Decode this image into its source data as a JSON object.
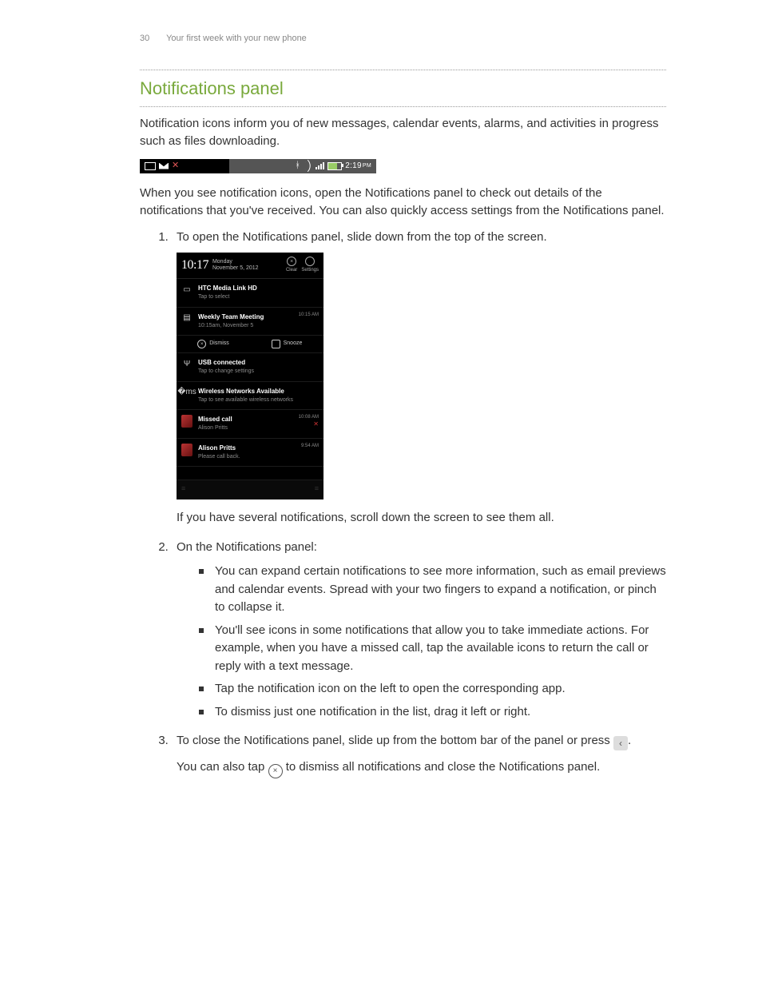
{
  "header": {
    "page_number": "30",
    "running_title": "Your first week with your new phone"
  },
  "section": {
    "title": "Notifications panel"
  },
  "intro1": "Notification icons inform you of new messages, calendar events, alarms, and activities in progress such as files downloading.",
  "statusbar": {
    "time": "2:19",
    "ampm": "PM"
  },
  "intro2": "When you see notification icons, open the Notifications panel to check out details of the notifications that you've received. You can also quickly access settings from the Notifications panel.",
  "steps": {
    "s1": "To open the Notifications panel, slide down from the top of the screen.",
    "s1_after": "If you have several notifications, scroll down the screen to see them all.",
    "s2_intro": "On the Notifications panel:",
    "s2_bullets": [
      "You can expand certain notifications to see more information, such as email previews and calendar events. Spread with your two fingers to expand a notification, or pinch to collapse it.",
      "You'll see icons in some notifications that allow you to take immediate actions. For example, when you have a missed call, tap the available icons to return the call or reply with a text message.",
      "Tap the notification icon on the left to open the corresponding app.",
      "To dismiss just one notification in the list, drag it left or right."
    ],
    "s3_a": "To close the Notifications panel, slide up from the bottom bar of the panel or press ",
    "s3_b": ".",
    "s3_after_a": "You can also tap ",
    "s3_after_b": " to dismiss all notifications and close the Notifications panel."
  },
  "panel": {
    "clock": "10:17",
    "day": "Monday",
    "date": "November 5, 2012",
    "clear": "Clear",
    "settings": "Settings",
    "dismiss": "Dismiss",
    "snooze": "Snooze",
    "rows": {
      "media": {
        "title": "HTC Media Link HD",
        "sub": "Tap to select"
      },
      "meeting": {
        "title": "Weekly Team Meeting",
        "sub": "10:15am, November 5",
        "time": "10:15 AM"
      },
      "usb": {
        "title": "USB connected",
        "sub": "Tap to change settings"
      },
      "wifi": {
        "title": "Wireless Networks Available",
        "sub": "Tap to see available wireless networks"
      },
      "missed": {
        "title": "Missed call",
        "sub": "Alison Pritts",
        "time": "10:08 AM"
      },
      "msg": {
        "title": "Alison Pritts",
        "sub": "Please call back.",
        "time": "9:54 AM"
      }
    }
  }
}
